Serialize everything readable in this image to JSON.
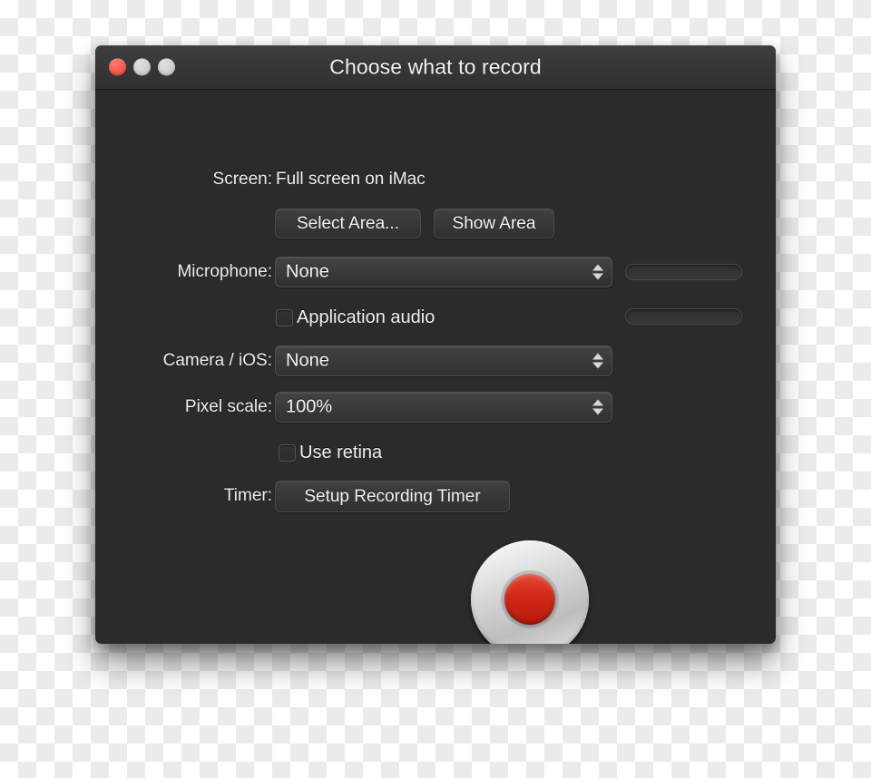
{
  "window": {
    "title": "Choose what to record",
    "traffic_lights": [
      {
        "name": "close",
        "color": "#f05245"
      },
      {
        "name": "minimize",
        "color": "#c9c9c9"
      },
      {
        "name": "zoom",
        "color": "#c9c9c9"
      }
    ]
  },
  "form": {
    "screen": {
      "label": "Screen:",
      "value": "Full screen on iMac",
      "select_area_button": "Select Area...",
      "show_area_button": "Show Area"
    },
    "microphone": {
      "label": "Microphone:",
      "value": "None"
    },
    "application_audio": {
      "label": "Application audio",
      "checked": false
    },
    "camera": {
      "label": "Camera / iOS:",
      "value": "None"
    },
    "pixel_scale": {
      "label": "Pixel scale:",
      "value": "100%"
    },
    "use_retina": {
      "label": "Use retina",
      "checked": false
    },
    "timer": {
      "label": "Timer:",
      "button": "Setup Recording Timer"
    }
  },
  "record": {
    "name": "record-button",
    "dot_color": "#cc2018",
    "ring_color": "#cfcfcf"
  },
  "colors": {
    "window_background": "#2b2b2b",
    "titlebar_top": "#3e3e3e",
    "titlebar_bottom": "#303030",
    "text": "#f0f0f0",
    "control_border": "#4e4e4e"
  }
}
